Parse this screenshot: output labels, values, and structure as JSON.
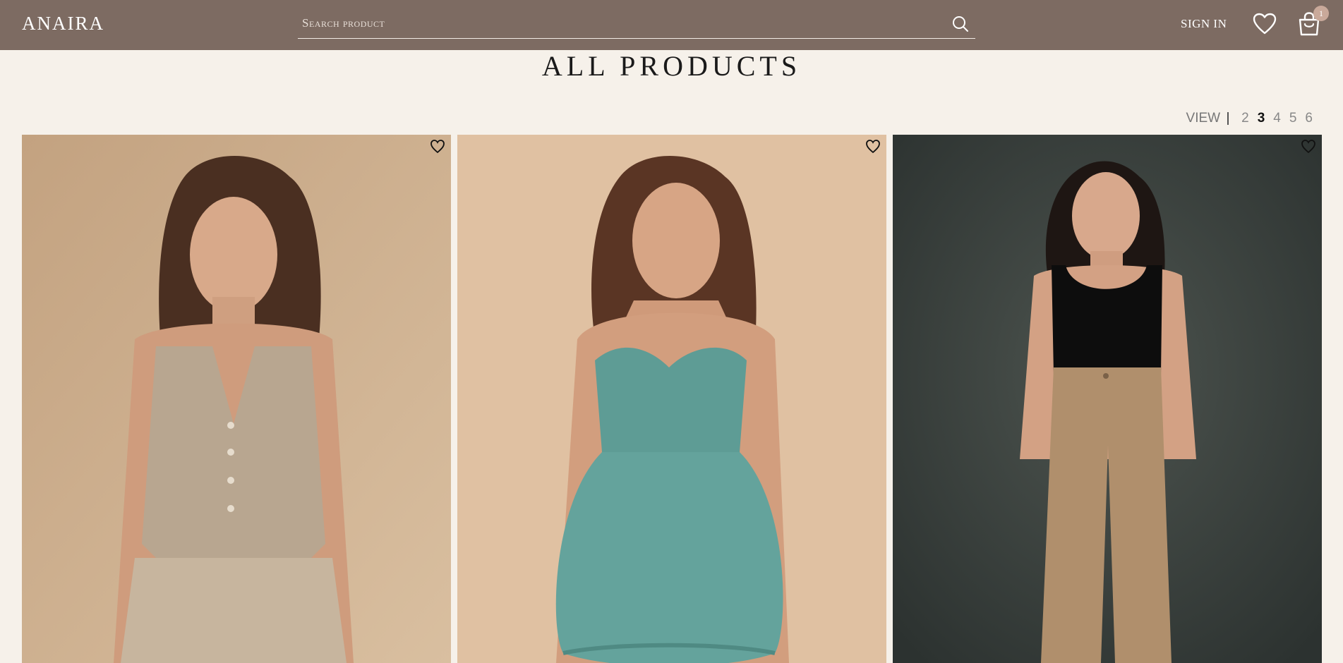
{
  "header": {
    "logo": "ANAIRA",
    "search_placeholder": "Search product",
    "signin_label": "SIGN IN",
    "cart_count": "1",
    "icons": {
      "search": "search-icon",
      "wishlist": "heart-icon",
      "cart": "shopping-bag-icon"
    }
  },
  "page": {
    "title": "ALL PRODUCTS"
  },
  "view": {
    "label": "VIEW",
    "options": [
      "2",
      "3",
      "4",
      "5",
      "6"
    ],
    "active": "3"
  },
  "products": [
    {
      "name": "linen-vest-set",
      "bg": "#c9ab8a",
      "garment": "#b8a690"
    },
    {
      "name": "teal-bubble-dress",
      "bg": "#dfbf9f",
      "garment": "#5e9c95"
    },
    {
      "name": "tank-flare-pants",
      "bg": "#3e4540",
      "garment": "#b08f6c"
    }
  ],
  "colors": {
    "header_bg": "#7d6b62",
    "page_bg": "#f6f1ea"
  }
}
